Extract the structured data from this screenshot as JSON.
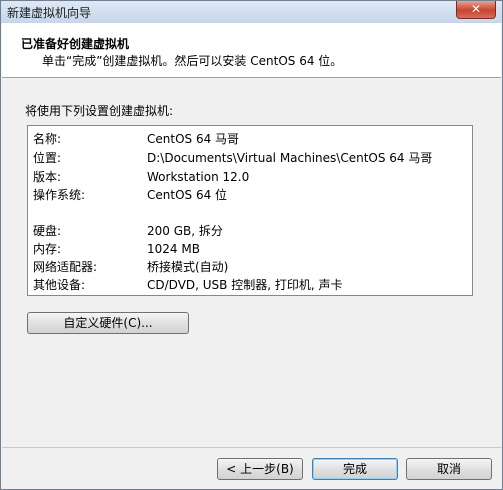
{
  "window": {
    "title": "新建虚拟机向导",
    "close_glyph": "✕"
  },
  "header": {
    "title": "已准备好创建虚拟机",
    "subtitle": "单击“完成”创建虚拟机。然后可以安装 CentOS 64 位。"
  },
  "intro": "将使用下列设置创建虚拟机:",
  "summary": [
    {
      "label": "名称:",
      "value": "CentOS 64  马哥"
    },
    {
      "label": "位置:",
      "value": "D:\\Documents\\Virtual Machines\\CentOS 64  马哥"
    },
    {
      "label": "版本:",
      "value": "Workstation 12.0"
    },
    {
      "label": "操作系统:",
      "value": "CentOS 64 位"
    },
    {
      "label": "硬盘:",
      "value": "200 GB, 拆分"
    },
    {
      "label": "内存:",
      "value": "1024 MB"
    },
    {
      "label": "网络适配器:",
      "value": "桥接模式(自动)"
    },
    {
      "label": "其他设备:",
      "value": "CD/DVD, USB 控制器, 打印机, 声卡"
    }
  ],
  "buttons": {
    "customize": "自定义硬件(C)...",
    "back": "< 上一步(B)",
    "finish": "完成",
    "cancel": "取消"
  }
}
